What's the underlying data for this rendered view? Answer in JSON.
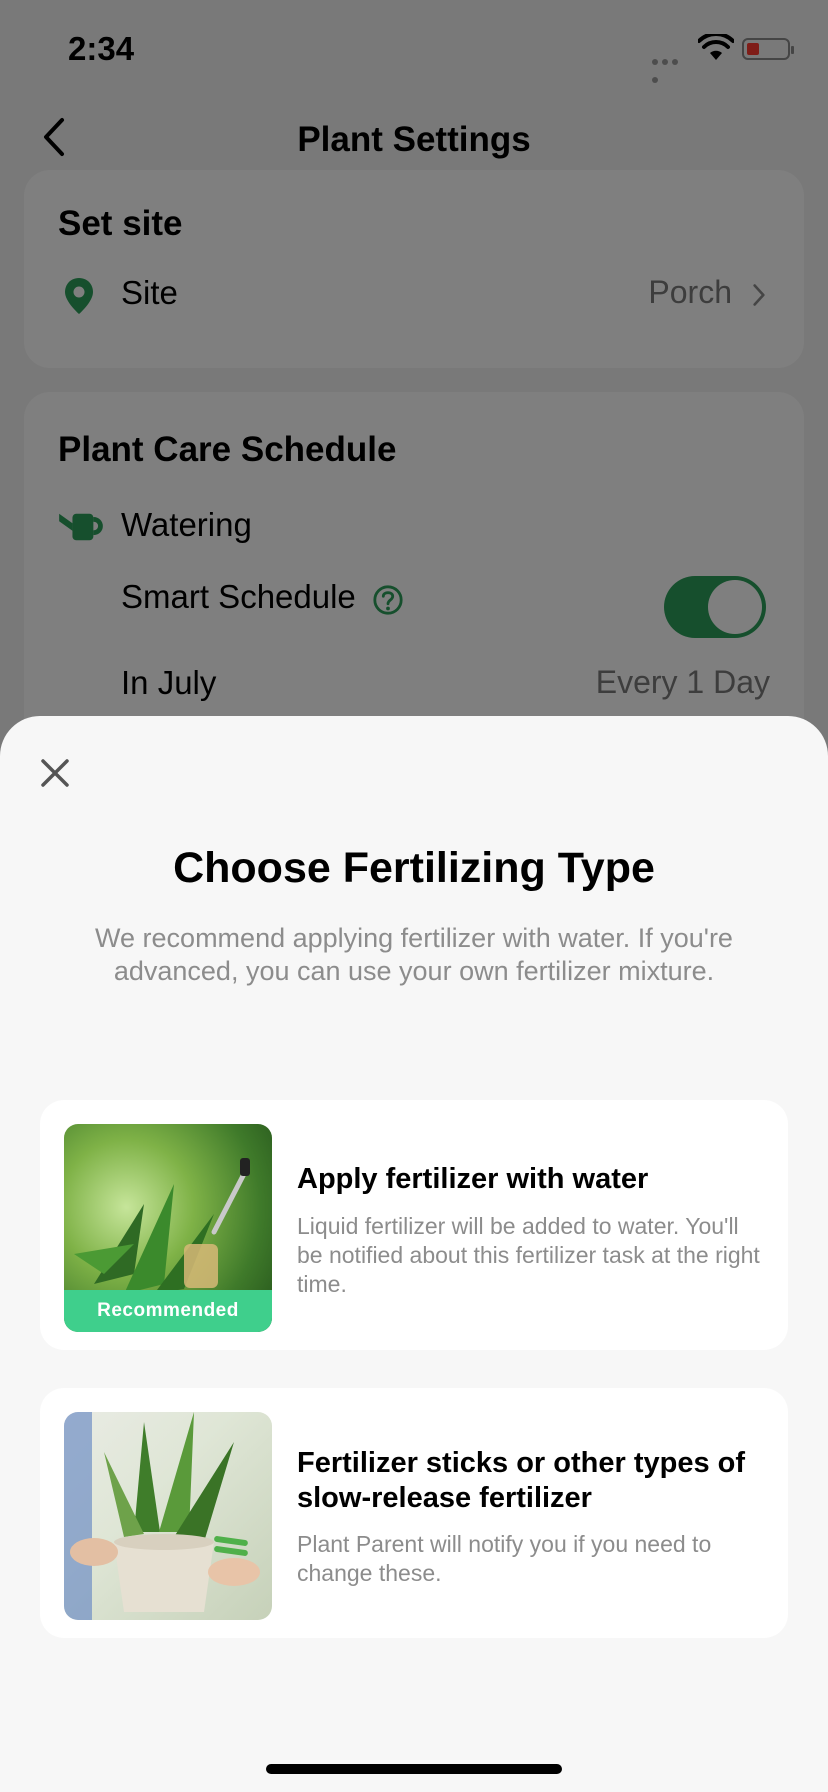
{
  "status_bar": {
    "time": "2:34"
  },
  "nav": {
    "title": "Plant Settings"
  },
  "site_card": {
    "heading": "Set site",
    "site_label": "Site",
    "site_value": "Porch"
  },
  "care_card": {
    "heading": "Plant Care Schedule",
    "watering_label": "Watering",
    "smart_schedule_label": "Smart Schedule",
    "smart_schedule_on": true,
    "month_label": "In July",
    "month_value": "Every 1 Day"
  },
  "sheet": {
    "title": "Choose Fertilizing Type",
    "description": "We recommend applying fertilizer with water. If you're advanced, you can use your own fertilizer mixture.",
    "options": [
      {
        "title": "Apply fertilizer with water",
        "description": "Liquid fertilizer will be added to water. You'll be notified about this fertilizer task at the right time.",
        "badge": "Recommended"
      },
      {
        "title": "Fertilizer sticks or other types of slow-release fertilizer",
        "description": "Plant Parent will notify you if you need to change these."
      }
    ]
  },
  "colors": {
    "accent_green": "#2d9f5a",
    "badge_green": "#3fcf8c",
    "battery_red": "#ff3b30"
  },
  "icons": {
    "back": "chevron-left-icon",
    "site": "location-pin-icon",
    "watering": "watering-can-icon",
    "help": "question-circle-icon",
    "chevron": "chevron-right-icon",
    "close": "close-icon"
  }
}
